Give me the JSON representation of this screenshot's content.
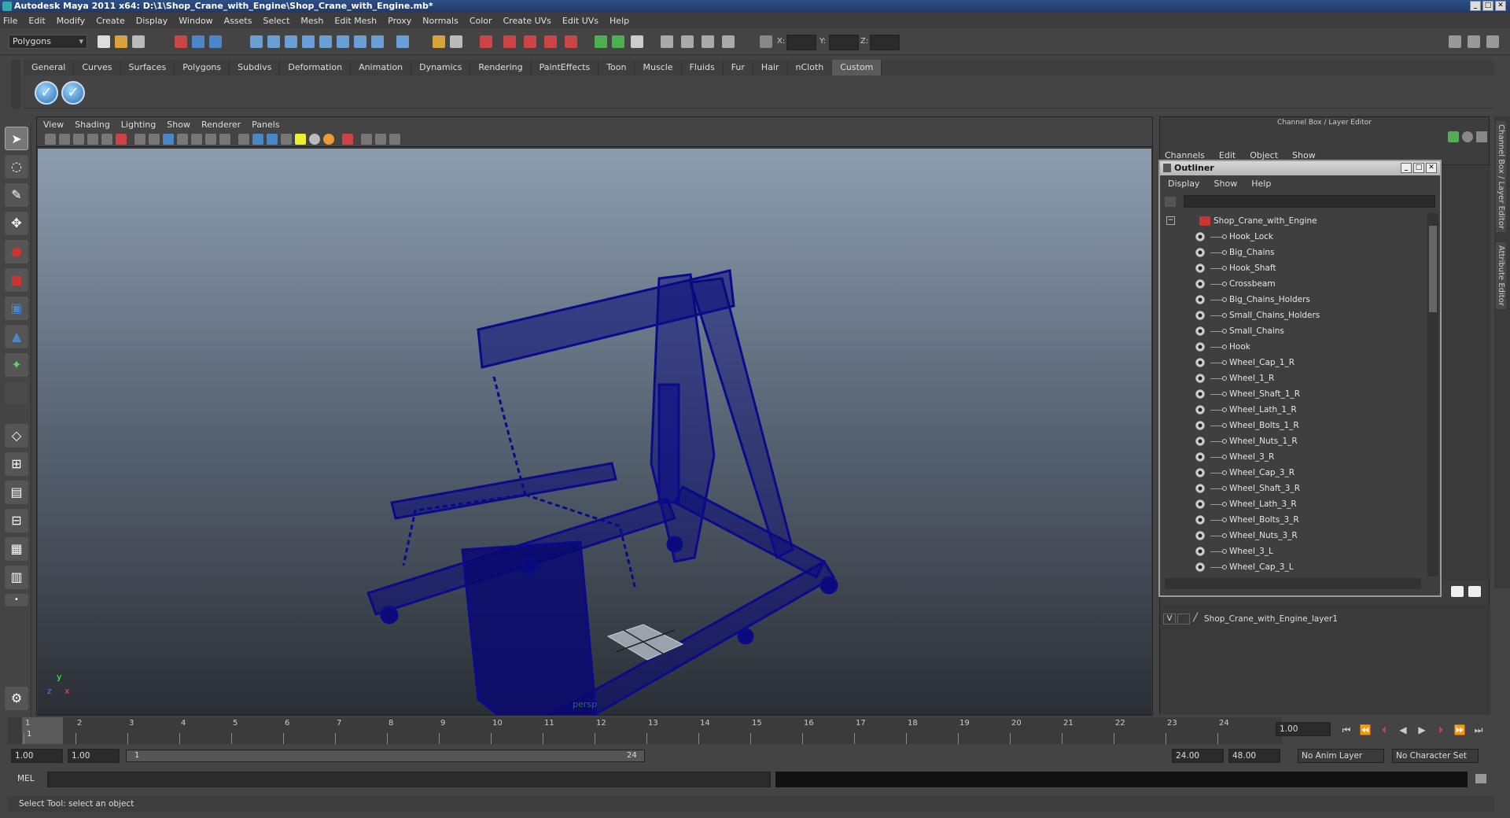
{
  "window": {
    "title": "Autodesk Maya 2011 x64: D:\\1\\Shop_Crane_with_Engine\\Shop_Crane_with_Engine.mb*"
  },
  "menubar": [
    "File",
    "Edit",
    "Modify",
    "Create",
    "Display",
    "Window",
    "Assets",
    "Select",
    "Mesh",
    "Edit Mesh",
    "Proxy",
    "Normals",
    "Color",
    "Create UVs",
    "Edit UVs",
    "Help"
  ],
  "status_line": {
    "mode": "Polygons",
    "x_label": "X:",
    "y_label": "Y:",
    "z_label": "Z:"
  },
  "shelf": {
    "tabs": [
      "General",
      "Curves",
      "Surfaces",
      "Polygons",
      "Subdivs",
      "Deformation",
      "Animation",
      "Dynamics",
      "Rendering",
      "PaintEffects",
      "Toon",
      "Muscle",
      "Fluids",
      "Fur",
      "Hair",
      "nCloth",
      "Custom"
    ],
    "active_tab": "Custom"
  },
  "viewport": {
    "menus": [
      "View",
      "Shading",
      "Lighting",
      "Show",
      "Renderer",
      "Panels"
    ],
    "camera_label": "persp",
    "axis_y": "y",
    "axis_x": "x",
    "axis_z": "z"
  },
  "channel_box": {
    "title": "Channel Box / Layer Editor",
    "menus": [
      "Channels",
      "Edit",
      "Object",
      "Show"
    ],
    "side_tabs": [
      "Channel Box / Layer Editor",
      "Attribute Editor"
    ]
  },
  "outliner": {
    "title": "Outliner",
    "menus": [
      "Display",
      "Show",
      "Help"
    ],
    "root": "Shop_Crane_with_Engine",
    "items": [
      "Hook_Lock",
      "Big_Chains",
      "Hook_Shaft",
      "Crossbeam",
      "Big_Chains_Holders",
      "Small_Chains_Holders",
      "Small_Chains",
      "Hook",
      "Wheel_Cap_1_R",
      "Wheel_1_R",
      "Wheel_Shaft_1_R",
      "Wheel_Lath_1_R",
      "Wheel_Bolts_1_R",
      "Wheel_Nuts_1_R",
      "Wheel_3_R",
      "Wheel_Cap_3_R",
      "Wheel_Shaft_3_R",
      "Wheel_Lath_3_R",
      "Wheel_Bolts_3_R",
      "Wheel_Nuts_3_R",
      "Wheel_3_L",
      "Wheel_Cap_3_L"
    ]
  },
  "layer_editor": {
    "visibility": "V",
    "layer_name": "Shop_Crane_with_Engine_layer1"
  },
  "time_slider": {
    "frames": [
      "1",
      "2",
      "3",
      "4",
      "5",
      "6",
      "7",
      "8",
      "9",
      "10",
      "11",
      "12",
      "13",
      "14",
      "15",
      "16",
      "17",
      "18",
      "19",
      "20",
      "21",
      "22",
      "23",
      "24"
    ],
    "current_frame": "1.00",
    "current_marker": "1"
  },
  "range_slider": {
    "start_time": "1.00",
    "playback_start": "1.00",
    "range_start_label": "1",
    "range_end_label": "24",
    "playback_end": "24.00",
    "end_time": "48.00",
    "anim_layer": "No Anim Layer",
    "character_set": "No Character Set"
  },
  "command_line": {
    "label": "MEL"
  },
  "help_line": {
    "text": "Select Tool: select an object"
  },
  "colors": {
    "wireframe": "#0a0a8a",
    "viewport_top": "#8d9db0",
    "viewport_bottom": "#2b2f35",
    "active_tab": "#5a5a5a"
  }
}
